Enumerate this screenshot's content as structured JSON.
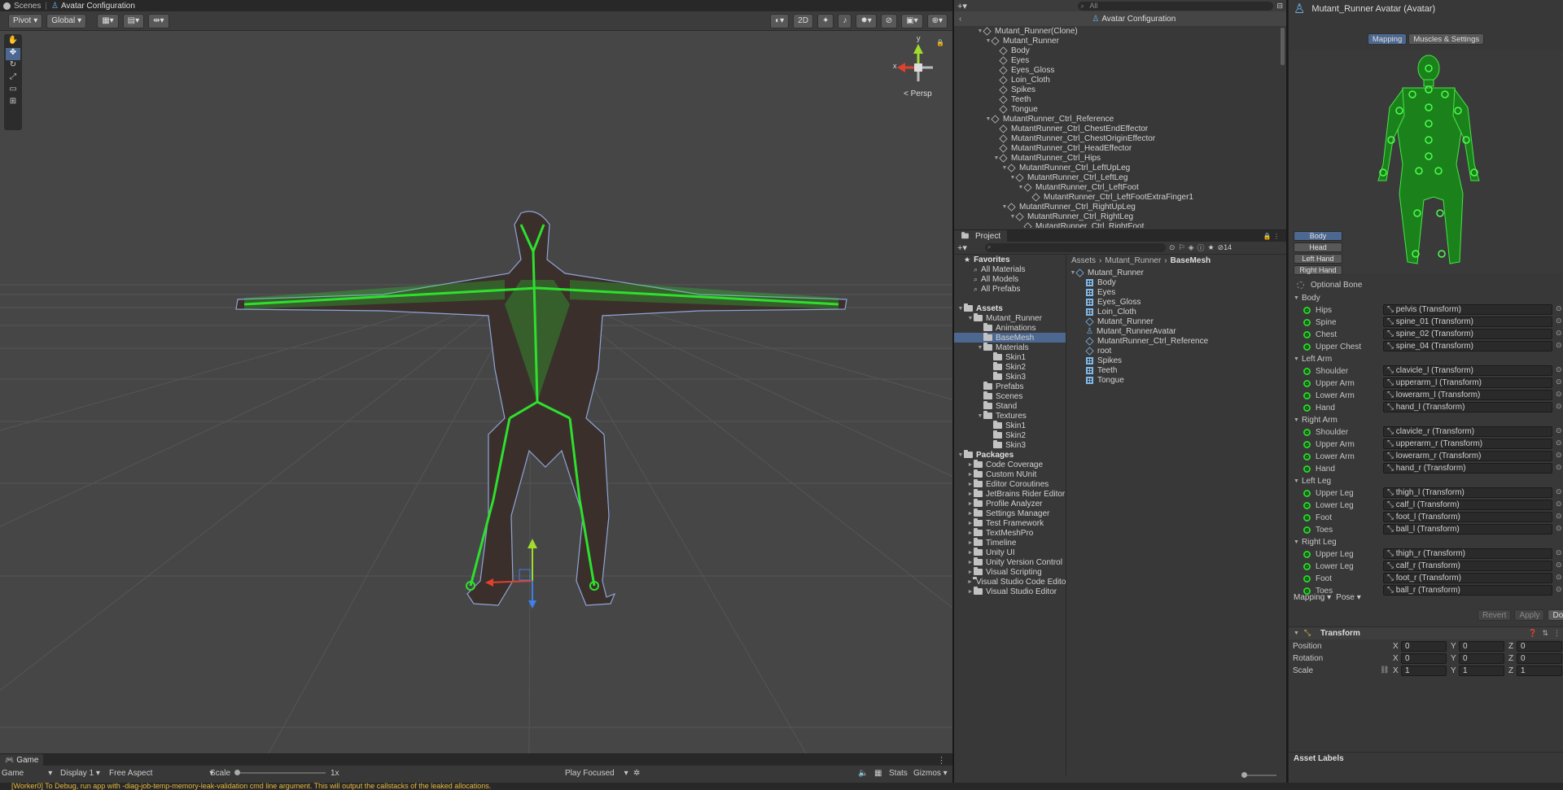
{
  "topbar": {
    "scenes_label": "Scenes",
    "breadcrumb": "Avatar Configuration"
  },
  "scene_toolbar": {
    "pivot": "Pivot",
    "global": "Global",
    "btn_2d": "2D",
    "persp": "Persp",
    "axis_x": "x",
    "axis_y": "y"
  },
  "hierarchy": {
    "search_placeholder": "All",
    "header": "Avatar Configuration",
    "items": [
      {
        "label": "Mutant_Runner(Clone)",
        "depth": 0,
        "expanded": true
      },
      {
        "label": "Mutant_Runner",
        "depth": 1,
        "expanded": true
      },
      {
        "label": "Body",
        "depth": 2
      },
      {
        "label": "Eyes",
        "depth": 2
      },
      {
        "label": "Eyes_Gloss",
        "depth": 2
      },
      {
        "label": "Loin_Cloth",
        "depth": 2
      },
      {
        "label": "Spikes",
        "depth": 2
      },
      {
        "label": "Teeth",
        "depth": 2
      },
      {
        "label": "Tongue",
        "depth": 2
      },
      {
        "label": "MutantRunner_Ctrl_Reference",
        "depth": 1,
        "expanded": true
      },
      {
        "label": "MutantRunner_Ctrl_ChestEndEffector",
        "depth": 2
      },
      {
        "label": "MutantRunner_Ctrl_ChestOriginEffector",
        "depth": 2
      },
      {
        "label": "MutantRunner_Ctrl_HeadEffector",
        "depth": 2
      },
      {
        "label": "MutantRunner_Ctrl_Hips",
        "depth": 2,
        "expanded": true
      },
      {
        "label": "MutantRunner_Ctrl_LeftUpLeg",
        "depth": 3,
        "expanded": true
      },
      {
        "label": "MutantRunner_Ctrl_LeftLeg",
        "depth": 4,
        "expanded": true
      },
      {
        "label": "MutantRunner_Ctrl_LeftFoot",
        "depth": 5,
        "expanded": true
      },
      {
        "label": "MutantRunner_Ctrl_LeftFootExtraFinger1",
        "depth": 6
      },
      {
        "label": "MutantRunner_Ctrl_RightUpLeg",
        "depth": 3,
        "expanded": true
      },
      {
        "label": "MutantRunner_Ctrl_RightLeg",
        "depth": 4,
        "expanded": true
      },
      {
        "label": "MutantRunner_Ctrl_RightFoot",
        "depth": 5
      }
    ]
  },
  "project": {
    "tab": "Project",
    "hidden_count": "14",
    "breadcrumb": [
      "Assets",
      "Mutant_Runner",
      "BaseMesh"
    ],
    "tree": [
      {
        "label": "Favorites",
        "depth": 0,
        "type": "star",
        "bold": true
      },
      {
        "label": "All Materials",
        "depth": 1,
        "type": "search"
      },
      {
        "label": "All Models",
        "depth": 1,
        "type": "search"
      },
      {
        "label": "All Prefabs",
        "depth": 1,
        "type": "search"
      },
      {
        "label": "",
        "depth": 0,
        "type": "gap"
      },
      {
        "label": "Assets",
        "depth": 0,
        "type": "folder",
        "bold": true,
        "tri": "▼"
      },
      {
        "label": "Mutant_Runner",
        "depth": 1,
        "type": "folder",
        "tri": "▼"
      },
      {
        "label": "Animations",
        "depth": 2,
        "type": "folder"
      },
      {
        "label": "BaseMesh",
        "depth": 2,
        "type": "folder",
        "selected": true
      },
      {
        "label": "Materials",
        "depth": 2,
        "type": "folder",
        "tri": "▼"
      },
      {
        "label": "Skin1",
        "depth": 3,
        "type": "folder"
      },
      {
        "label": "Skin2",
        "depth": 3,
        "type": "folder"
      },
      {
        "label": "Skin3",
        "depth": 3,
        "type": "folder"
      },
      {
        "label": "Prefabs",
        "depth": 2,
        "type": "folder"
      },
      {
        "label": "Scenes",
        "depth": 2,
        "type": "folder"
      },
      {
        "label": "Stand",
        "depth": 2,
        "type": "folder"
      },
      {
        "label": "Textures",
        "depth": 2,
        "type": "folder",
        "tri": "▼"
      },
      {
        "label": "Skin1",
        "depth": 3,
        "type": "folder"
      },
      {
        "label": "Skin2",
        "depth": 3,
        "type": "folder"
      },
      {
        "label": "Skin3",
        "depth": 3,
        "type": "folder"
      },
      {
        "label": "Packages",
        "depth": 0,
        "type": "folder",
        "bold": true,
        "tri": "▼"
      },
      {
        "label": "Code Coverage",
        "depth": 1,
        "type": "folder",
        "tri": "►"
      },
      {
        "label": "Custom NUnit",
        "depth": 1,
        "type": "folder",
        "tri": "►"
      },
      {
        "label": "Editor Coroutines",
        "depth": 1,
        "type": "folder",
        "tri": "►"
      },
      {
        "label": "JetBrains Rider Editor",
        "depth": 1,
        "type": "folder",
        "tri": "►"
      },
      {
        "label": "Profile Analyzer",
        "depth": 1,
        "type": "folder",
        "tri": "►"
      },
      {
        "label": "Settings Manager",
        "depth": 1,
        "type": "folder",
        "tri": "►"
      },
      {
        "label": "Test Framework",
        "depth": 1,
        "type": "folder",
        "tri": "►"
      },
      {
        "label": "TextMeshPro",
        "depth": 1,
        "type": "folder",
        "tri": "►"
      },
      {
        "label": "Timeline",
        "depth": 1,
        "type": "folder",
        "tri": "►"
      },
      {
        "label": "Unity UI",
        "depth": 1,
        "type": "folder",
        "tri": "►"
      },
      {
        "label": "Unity Version Control",
        "depth": 1,
        "type": "folder",
        "tri": "►"
      },
      {
        "label": "Visual Scripting",
        "depth": 1,
        "type": "folder",
        "tri": "►"
      },
      {
        "label": "Visual Studio Code Editor",
        "depth": 1,
        "type": "folder",
        "tri": "►"
      },
      {
        "label": "Visual Studio Editor",
        "depth": 1,
        "type": "folder",
        "tri": "►"
      }
    ],
    "contents": [
      {
        "label": "Mutant_Runner",
        "type": "model",
        "depth": 0
      },
      {
        "label": "Body",
        "type": "mesh",
        "depth": 1
      },
      {
        "label": "Eyes",
        "type": "mesh",
        "depth": 1
      },
      {
        "label": "Eyes_Gloss",
        "type": "mesh",
        "depth": 1
      },
      {
        "label": "Loin_Cloth",
        "type": "mesh",
        "depth": 1
      },
      {
        "label": "Mutant_Runner",
        "type": "model",
        "depth": 1
      },
      {
        "label": "Mutant_RunnerAvatar",
        "type": "avatar",
        "depth": 1
      },
      {
        "label": "MutantRunner_Ctrl_Reference",
        "type": "model",
        "depth": 1
      },
      {
        "label": "root",
        "type": "model",
        "depth": 1
      },
      {
        "label": "Spikes",
        "type": "mesh",
        "depth": 1
      },
      {
        "label": "Teeth",
        "type": "mesh",
        "depth": 1
      },
      {
        "label": "Tongue",
        "type": "mesh",
        "depth": 1
      }
    ]
  },
  "inspector": {
    "title": "Mutant_Runner Avatar (Avatar)",
    "tab_mapping": "Mapping",
    "tab_muscles": "Muscles & Settings",
    "body_buttons": [
      "Body",
      "Head",
      "Left Hand",
      "Right Hand"
    ],
    "optional_bone": "Optional Bone",
    "groups": [
      {
        "name": "Body",
        "bones": [
          [
            "Hips",
            "pelvis (Transform)"
          ],
          [
            "Spine",
            "spine_01 (Transform)"
          ],
          [
            "Chest",
            "spine_02 (Transform)"
          ],
          [
            "Upper Chest",
            "spine_04 (Transform)"
          ]
        ]
      },
      {
        "name": "Left Arm",
        "bones": [
          [
            "Shoulder",
            "clavicle_l (Transform)"
          ],
          [
            "Upper Arm",
            "upperarm_l (Transform)"
          ],
          [
            "Lower Arm",
            "lowerarm_l (Transform)"
          ],
          [
            "Hand",
            "hand_l (Transform)"
          ]
        ]
      },
      {
        "name": "Right Arm",
        "bones": [
          [
            "Shoulder",
            "clavicle_r (Transform)"
          ],
          [
            "Upper Arm",
            "upperarm_r (Transform)"
          ],
          [
            "Lower Arm",
            "lowerarm_r (Transform)"
          ],
          [
            "Hand",
            "hand_r (Transform)"
          ]
        ]
      },
      {
        "name": "Left Leg",
        "bones": [
          [
            "Upper Leg",
            "thigh_l (Transform)"
          ],
          [
            "Lower Leg",
            "calf_l (Transform)"
          ],
          [
            "Foot",
            "foot_l (Transform)"
          ],
          [
            "Toes",
            "ball_l (Transform)"
          ]
        ]
      },
      {
        "name": "Right Leg",
        "bones": [
          [
            "Upper Leg",
            "thigh_r (Transform)"
          ],
          [
            "Lower Leg",
            "calf_r (Transform)"
          ],
          [
            "Foot",
            "foot_r (Transform)"
          ],
          [
            "Toes",
            "ball_r (Transform)"
          ]
        ]
      }
    ],
    "mapping_dropdown": "Mapping",
    "pose_dropdown": "Pose",
    "revert": "Revert",
    "apply": "Apply",
    "done": "Done",
    "transform": {
      "title": "Transform",
      "rows": [
        {
          "label": "Position",
          "x": "0",
          "y": "0",
          "z": "0"
        },
        {
          "label": "Rotation",
          "x": "0",
          "y": "0",
          "z": "0"
        },
        {
          "label": "Scale",
          "x": "1",
          "y": "1",
          "z": "1"
        }
      ]
    },
    "asset_labels": "Asset Labels"
  },
  "game": {
    "tab": "Game",
    "view": "Game",
    "display": "Display 1",
    "aspect": "Free Aspect",
    "scale_label": "Scale",
    "scale_value": "1x",
    "play_focused": "Play Focused",
    "stats": "Stats",
    "gizmos": "Gizmos"
  },
  "console": "[Worker0] To Debug, run app with -diag-job-temp-memory-leak-validation cmd line argument. This will output the callstacks of the leaked allocations.",
  "colors": {
    "accent": "#4d6890",
    "bone": "#2ed02e",
    "bg_panel": "#383838",
    "scene_bg": "#464646"
  }
}
